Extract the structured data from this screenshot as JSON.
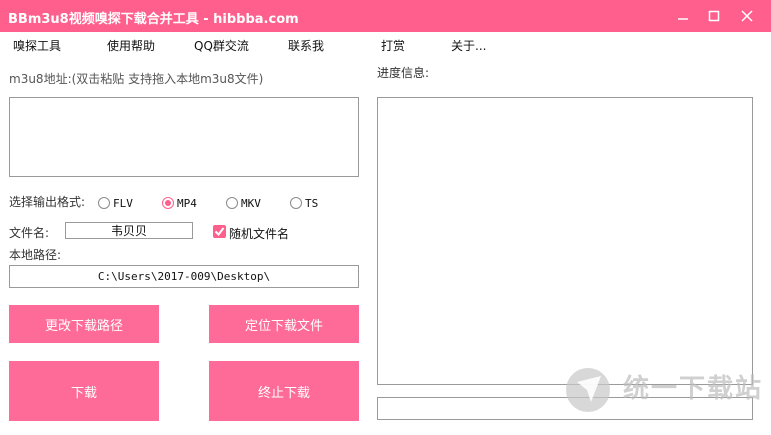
{
  "window": {
    "title": "BBm3u8视频嗅探下载合并工具 - hibbba.com"
  },
  "menu": [
    "嗅探工具",
    "使用帮助",
    "QQ群交流",
    "联系我",
    "打赏",
    "关于..."
  ],
  "m3u8": {
    "label": "m3u8地址:(双击粘贴 支持拖入本地m3u8文件)",
    "value": ""
  },
  "progress": {
    "label": "进度信息:",
    "log": "",
    "status": ""
  },
  "format": {
    "label": "选择输出格式:",
    "options": [
      "FLV",
      "MP4",
      "MKV",
      "TS"
    ],
    "selected": "MP4"
  },
  "filename": {
    "label": "文件名:",
    "value": "韦贝贝"
  },
  "random_name": {
    "label": "随机文件名",
    "checked": true
  },
  "path": {
    "label": "本地路径:",
    "value": "C:\\Users\\2017-009\\Desktop\\"
  },
  "buttons": {
    "change_path": "更改下载路径",
    "locate_file": "定位下载文件",
    "download": "下载",
    "stop": "终止下载"
  },
  "watermark": {
    "text": "统一下载站"
  },
  "colors": {
    "accent": "#ff5f8c",
    "button": "#ff6b98"
  }
}
